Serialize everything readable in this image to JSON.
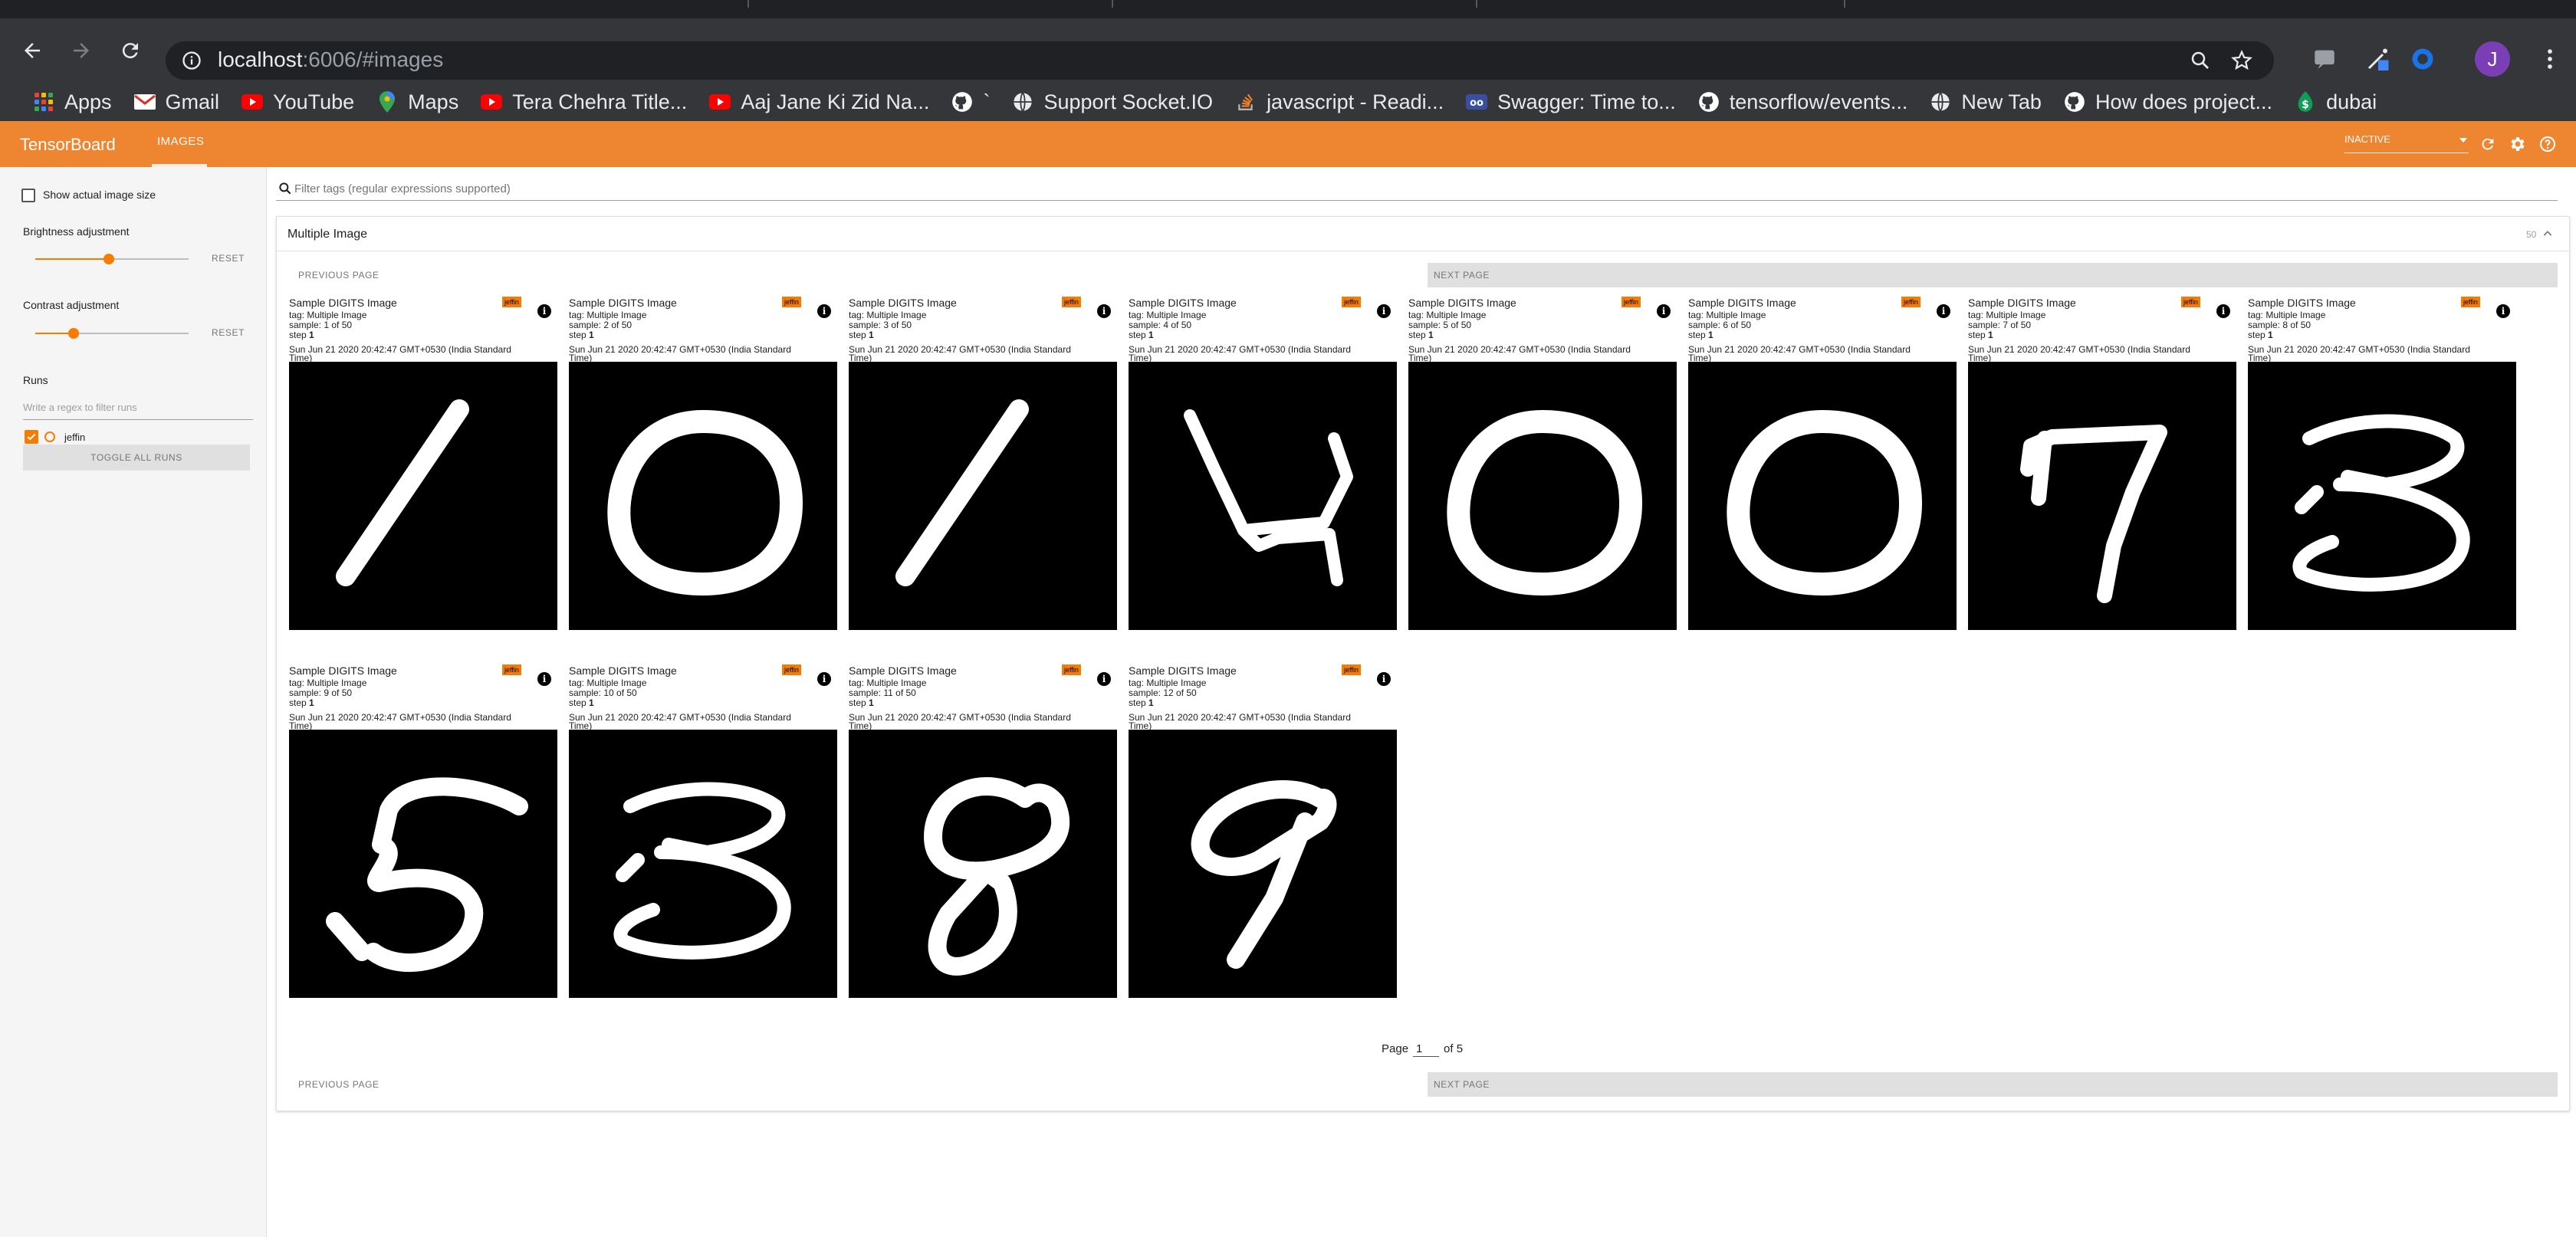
{
  "browser": {
    "url_host": "localhost",
    "url_rest": ":6006/#images",
    "avatar_letter": "J",
    "bookmarks": [
      {
        "label": "Apps",
        "icon": "apps-grid-icon"
      },
      {
        "label": "Gmail",
        "icon": "gmail-icon",
        "color": "#d93025"
      },
      {
        "label": "YouTube",
        "icon": "youtube-icon",
        "color": "#ff0000"
      },
      {
        "label": "Maps",
        "icon": "maps-icon",
        "color": "#34a853"
      },
      {
        "label": "Tera Chehra Title...",
        "icon": "youtube-icon",
        "color": "#ff0000"
      },
      {
        "label": "Aaj Jane Ki Zid Na...",
        "icon": "youtube-icon",
        "color": "#ff0000"
      },
      {
        "label": "`",
        "icon": "github-icon",
        "color": "#ffffff"
      },
      {
        "label": "Support Socket.IO",
        "icon": "globe-icon",
        "color": "#e8eaed"
      },
      {
        "label": "javascript - Readi...",
        "icon": "stackoverflow-icon",
        "color": "#f48024"
      },
      {
        "label": "Swagger: Time to...",
        "icon": "swagger-icon",
        "color": "#3b4fa0"
      },
      {
        "label": "tensorflow/events...",
        "icon": "github-icon",
        "color": "#ffffff"
      },
      {
        "label": "New Tab",
        "icon": "globe-icon",
        "color": "#e8eaed"
      },
      {
        "label": "How does project...",
        "icon": "github-icon",
        "color": "#ffffff"
      },
      {
        "label": "dubai",
        "icon": "dollar-icon",
        "color": "#0f9d58"
      }
    ]
  },
  "tensorboard": {
    "title": "TensorBoard",
    "tab": "IMAGES",
    "status": "INACTIVE",
    "accent": "#ee8631"
  },
  "sidebar": {
    "show_actual_size": "Show actual image size",
    "brightness_label": "Brightness adjustment",
    "brightness_value": 0.48,
    "contrast_label": "Contrast adjustment",
    "contrast_value": 0.25,
    "reset_label": "RESET",
    "runs_label": "Runs",
    "runs_filter_placeholder": "Write a regex to filter runs",
    "run_name": "jeffin",
    "toggle_all": "TOGGLE ALL RUNS"
  },
  "main": {
    "filter_placeholder": "Filter tags (regular expressions supported)",
    "card_title": "Multiple Image",
    "card_count": "50",
    "prev_page": "PREVIOUS PAGE",
    "next_page": "NEXT PAGE",
    "page_label": "Page",
    "page_current": "1",
    "page_total": "of 5",
    "tiles": [
      {
        "title": "Sample DIGITS Image",
        "run": "jeffin",
        "tag": "tag: Multiple Image",
        "sample": "sample: 1 of 50",
        "step_label": "step",
        "step": "1",
        "time1": "Sun Jun 21 2020 20:42:47 GMT+0530 (India Standard",
        "time2": "Time)",
        "digit": "1"
      },
      {
        "title": "Sample DIGITS Image",
        "run": "jeffin",
        "tag": "tag: Multiple Image",
        "sample": "sample: 2 of 50",
        "step_label": "step",
        "step": "1",
        "time1": "Sun Jun 21 2020 20:42:47 GMT+0530 (India Standard",
        "time2": "Time)",
        "digit": "0"
      },
      {
        "title": "Sample DIGITS Image",
        "run": "jeffin",
        "tag": "tag: Multiple Image",
        "sample": "sample: 3 of 50",
        "step_label": "step",
        "step": "1",
        "time1": "Sun Jun 21 2020 20:42:47 GMT+0530 (India Standard",
        "time2": "Time)",
        "digit": "1"
      },
      {
        "title": "Sample DIGITS Image",
        "run": "jeffin",
        "tag": "tag: Multiple Image",
        "sample": "sample: 4 of 50",
        "step_label": "step",
        "step": "1",
        "time1": "Sun Jun 21 2020 20:42:47 GMT+0530 (India Standard",
        "time2": "Time)",
        "digit": "4"
      },
      {
        "title": "Sample DIGITS Image",
        "run": "jeffin",
        "tag": "tag: Multiple Image",
        "sample": "sample: 5 of 50",
        "step_label": "step",
        "step": "1",
        "time1": "Sun Jun 21 2020 20:42:47 GMT+0530 (India Standard",
        "time2": "Time)",
        "digit": "0"
      },
      {
        "title": "Sample DIGITS Image",
        "run": "jeffin",
        "tag": "tag: Multiple Image",
        "sample": "sample: 6 of 50",
        "step_label": "step",
        "step": "1",
        "time1": "Sun Jun 21 2020 20:42:47 GMT+0530 (India Standard",
        "time2": "Time)",
        "digit": "0"
      },
      {
        "title": "Sample DIGITS Image",
        "run": "jeffin",
        "tag": "tag: Multiple Image",
        "sample": "sample: 7 of 50",
        "step_label": "step",
        "step": "1",
        "time1": "Sun Jun 21 2020 20:42:47 GMT+0530 (India Standard",
        "time2": "Time)",
        "digit": "7"
      },
      {
        "title": "Sample DIGITS Image",
        "run": "jeffin",
        "tag": "tag: Multiple Image",
        "sample": "sample: 8 of 50",
        "step_label": "step",
        "step": "1",
        "time1": "Sun Jun 21 2020 20:42:47 GMT+0530 (India Standard",
        "time2": "Time)",
        "digit": "3"
      },
      {
        "title": "Sample DIGITS Image",
        "run": "jeffin",
        "tag": "tag: Multiple Image",
        "sample": "sample: 9 of 50",
        "step_label": "step",
        "step": "1",
        "time1": "Sun Jun 21 2020 20:42:47 GMT+0530 (India Standard",
        "time2": "Time)",
        "digit": "5"
      },
      {
        "title": "Sample DIGITS Image",
        "run": "jeffin",
        "tag": "tag: Multiple Image",
        "sample": "sample: 10 of 50",
        "step_label": "step",
        "step": "1",
        "time1": "Sun Jun 21 2020 20:42:47 GMT+0530 (India Standard",
        "time2": "Time)",
        "digit": "3"
      },
      {
        "title": "Sample DIGITS Image",
        "run": "jeffin",
        "tag": "tag: Multiple Image",
        "sample": "sample: 11 of 50",
        "step_label": "step",
        "step": "1",
        "time1": "Sun Jun 21 2020 20:42:47 GMT+0530 (India Standard",
        "time2": "Time)",
        "digit": "8"
      },
      {
        "title": "Sample DIGITS Image",
        "run": "jeffin",
        "tag": "tag: Multiple Image",
        "sample": "sample: 12 of 50",
        "step_label": "step",
        "step": "1",
        "time1": "Sun Jun 21 2020 20:42:47 GMT+0530 (India Standard",
        "time2": "Time)",
        "digit": "9"
      }
    ]
  }
}
